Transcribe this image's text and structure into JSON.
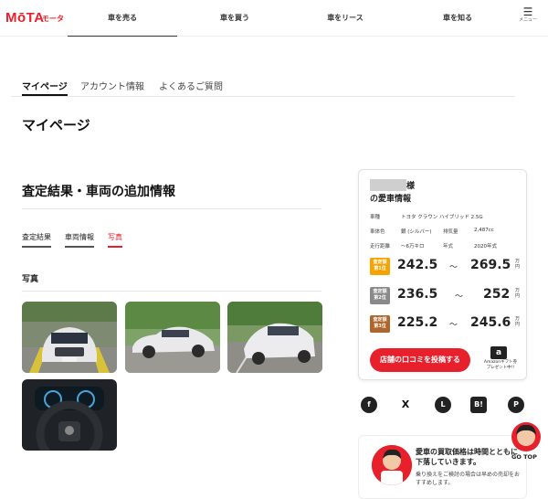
{
  "header": {
    "logo": "MōTA",
    "logo_sub": "モータ",
    "nav": [
      "車を売る",
      "車を買う",
      "車をリース",
      "車を知る"
    ],
    "menu_label": "メニュー",
    "menu_icon": "hamburger-icon"
  },
  "tabs": [
    "マイページ",
    "アカウント情報",
    "よくあるご質問"
  ],
  "page_title": "マイページ",
  "section_title": "査定結果・車両の追加情報",
  "subtabs": [
    "査定結果",
    "車両情報",
    "写真"
  ],
  "photos_title": "写真",
  "card": {
    "sama": "様",
    "title": "の愛車情報",
    "specs": {
      "model_label": "車種",
      "model_value": "トヨタ クラウン ハイブリッド 2.5G",
      "color_label": "車体色",
      "color_value": "銀 (シルバー)",
      "displacement_label": "排気量",
      "displacement_value": "2,487cc",
      "mileage_label": "走行距離",
      "mileage_value": "〜6万キロ",
      "year_label": "年式",
      "year_value": "2020年式"
    },
    "ranks": [
      {
        "label": "査定額\n第1位",
        "min": "242.5",
        "max": "269.5",
        "color": "#f5a300"
      },
      {
        "label": "査定額\n第2位",
        "min": "236.5",
        "max": "252",
        "color": "#8a8a8a"
      },
      {
        "label": "査定額\n第3位",
        "min": "225.2",
        "max": "245.6",
        "color": "#b0652a"
      }
    ],
    "tilde": "〜",
    "unit": "万円",
    "post_button": "店舗の口コミを投稿する",
    "amazon_text": "Amazonギフト券\nプレゼント中!!",
    "amazon_icon": "a"
  },
  "share": [
    {
      "icon": "facebook-icon",
      "glyph": "f"
    },
    {
      "icon": "x-icon",
      "glyph": "X"
    },
    {
      "icon": "line-icon",
      "glyph": "L"
    },
    {
      "icon": "hatena-icon",
      "glyph": "B!"
    },
    {
      "icon": "pinterest-icon",
      "glyph": "P"
    }
  ],
  "promo": {
    "head": "愛車の買取価格は時間とともに下落していきます。",
    "body": "乗り換えをご検討の場合は早めの売却をおすすめします。",
    "badge": "MōTA"
  },
  "gotop": "GO TOP",
  "accent": "#e8202c"
}
